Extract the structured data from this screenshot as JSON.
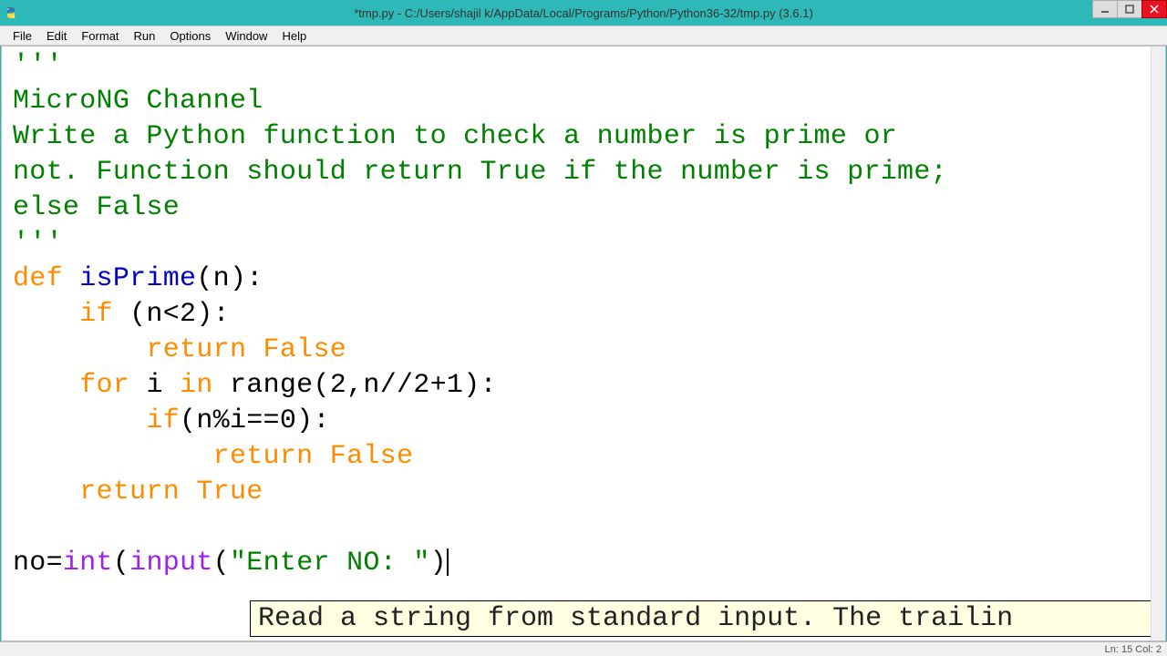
{
  "window": {
    "title": "*tmp.py - C:/Users/shajil k/AppData/Local/Programs/Python/Python36-32/tmp.py (3.6.1)"
  },
  "menu": {
    "file": "File",
    "edit": "Edit",
    "format": "Format",
    "run": "Run",
    "options": "Options",
    "window": "Window",
    "help": "Help"
  },
  "code": {
    "l1": "'''",
    "l2": "MicroNG Channel",
    "l3": "Write a Python function to check a number is prime or",
    "l4": "not. Function should return True if the number is prime;",
    "l5": "else False",
    "l6": "'''",
    "l7_def": "def",
    "l7_name": " isPrime",
    "l7_rest": "(n):",
    "l8_pre": "    ",
    "l8_kw": "if",
    "l8_rest": " (n<2):",
    "l9_pre": "        ",
    "l9_kw": "return False",
    "l10_pre": "    ",
    "l10_kw1": "for",
    "l10_mid1": " i ",
    "l10_kw2": "in",
    "l10_mid2": " range(2,n//2+1):",
    "l11_pre": "        ",
    "l11_kw": "if",
    "l11_rest": "(n%i==0):",
    "l12_pre": "            ",
    "l12_kw": "return False",
    "l13_pre": "    ",
    "l13_kw": "return True",
    "l14": "",
    "l15_a": "no=",
    "l15_int": "int",
    "l15_b": "(",
    "l15_input": "input",
    "l15_c": "(",
    "l15_str": "\"Enter NO: \"",
    "l15_d": ")"
  },
  "tooltip": {
    "text": "Read a string from standard input.  The trailin"
  },
  "status": {
    "text": "Ln: 15  Col: 2"
  }
}
